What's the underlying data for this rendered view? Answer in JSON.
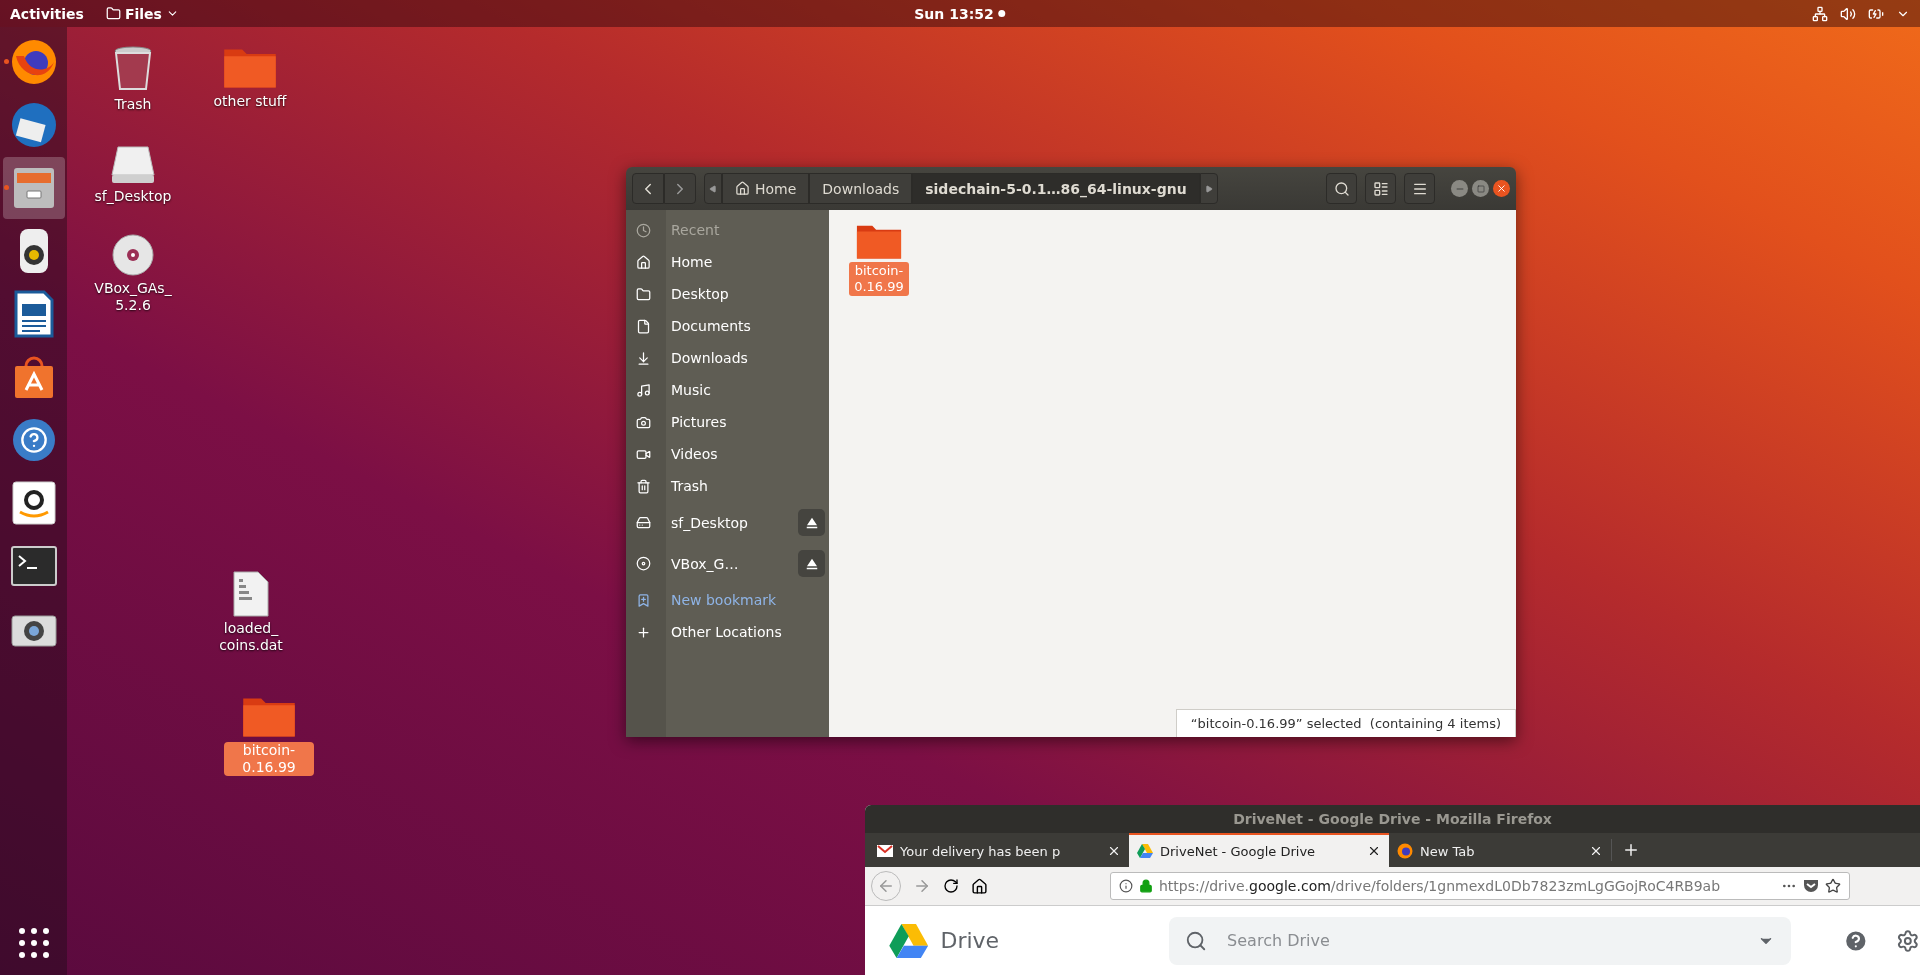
{
  "top_bar": {
    "activities": "Activities",
    "app_menu": "Files",
    "clock": "Sun 13:52"
  },
  "dock": [
    {
      "kind": "firefox",
      "running": true,
      "selected": false
    },
    {
      "kind": "mail",
      "running": false,
      "selected": false
    },
    {
      "kind": "files",
      "running": true,
      "selected": true
    },
    {
      "kind": "speaker",
      "running": false,
      "selected": false
    },
    {
      "kind": "document",
      "running": false,
      "selected": false
    },
    {
      "kind": "store",
      "running": false,
      "selected": false
    },
    {
      "kind": "help",
      "running": false,
      "selected": false
    },
    {
      "kind": "shop",
      "running": false,
      "selected": false
    },
    {
      "kind": "terminal",
      "running": false,
      "selected": false
    },
    {
      "kind": "camera",
      "running": false,
      "selected": false
    }
  ],
  "desktop_icons": [
    {
      "kind": "trash",
      "label": "Trash",
      "selected": false
    },
    {
      "kind": "folder",
      "label": "other stuff",
      "selected": false
    },
    {
      "kind": "drive",
      "label": "sf_Desktop",
      "selected": false
    },
    {
      "kind": "disc",
      "label": "VBox_GAs_ 5.2.6",
      "selected": false
    },
    {
      "kind": "file",
      "label": "loaded_ coins.dat",
      "selected": false
    },
    {
      "kind": "folder",
      "label": "bitcoin- 0.16.99",
      "selected": true
    }
  ],
  "files_window": {
    "path": [
      {
        "kind": "home",
        "label": "Home",
        "selected": false
      },
      {
        "kind": "folder",
        "label": "Downloads",
        "selected": false
      },
      {
        "kind": "folder",
        "label": "sidechain-5-0.1…86_64-linux-gnu",
        "selected": true
      }
    ],
    "sidebar": [
      {
        "kind": "recent",
        "label": "Recent",
        "disabled": true,
        "ejectable": false
      },
      {
        "kind": "home",
        "label": "Home",
        "disabled": false,
        "ejectable": false
      },
      {
        "kind": "desktop",
        "label": "Desktop",
        "disabled": false,
        "ejectable": false
      },
      {
        "kind": "documents",
        "label": "Documents",
        "disabled": false,
        "ejectable": false
      },
      {
        "kind": "downloads",
        "label": "Downloads",
        "disabled": false,
        "ejectable": false
      },
      {
        "kind": "music",
        "label": "Music",
        "disabled": false,
        "ejectable": false
      },
      {
        "kind": "pictures",
        "label": "Pictures",
        "disabled": false,
        "ejectable": false
      },
      {
        "kind": "videos",
        "label": "Videos",
        "disabled": false,
        "ejectable": false
      },
      {
        "kind": "trash",
        "label": "Trash",
        "disabled": false,
        "ejectable": false
      },
      {
        "kind": "drive",
        "label": "sf_Desktop",
        "disabled": false,
        "ejectable": true
      },
      {
        "kind": "disc",
        "label": "VBox_G…",
        "disabled": false,
        "ejectable": true
      },
      {
        "kind": "bookmark",
        "label": "New bookmark",
        "disabled": false,
        "ejectable": false
      },
      {
        "kind": "other",
        "label": "Other Locations",
        "disabled": false,
        "ejectable": false
      }
    ],
    "items": [
      {
        "label": "bitcoin- 0.16.99",
        "selected": true
      }
    ],
    "status": "“bitcoin-0.16.99” selected  (containing 4 items)"
  },
  "browser": {
    "title": "DriveNet - Google Drive - Mozilla Firefox",
    "tabs": [
      {
        "kind": "mail",
        "label": "Your delivery has been p",
        "selected": false
      },
      {
        "kind": "drive",
        "label": "DriveNet - Google Drive",
        "selected": true
      },
      {
        "kind": "firefox",
        "label": "New Tab",
        "selected": false
      }
    ],
    "url": [
      {
        "text": "https://drive.",
        "strong": false
      },
      {
        "text": "google.com",
        "strong": true
      },
      {
        "text": "/drive/folders/1gnmexdL0Db7823zmLgGGojRoC4RB9ab",
        "strong": false
      }
    ],
    "app_name": "Drive",
    "search": {
      "placeholder": "Search Drive"
    }
  }
}
